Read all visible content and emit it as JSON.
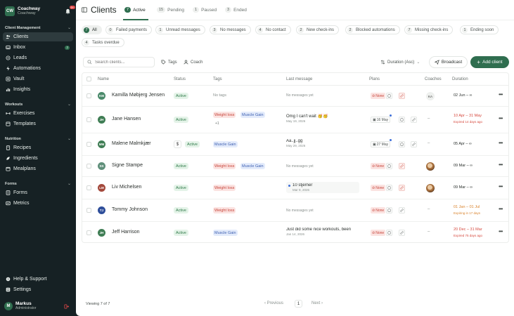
{
  "brand": {
    "logo_text": "CW",
    "name": "Coachway",
    "subtitle": "Coachway",
    "notifications": "9+"
  },
  "sidebar": {
    "sections": [
      {
        "title": "Client Management"
      },
      {
        "title": "Workouts"
      },
      {
        "title": "Nutrition"
      },
      {
        "title": "Forms"
      }
    ],
    "items": [
      {
        "label": "Clients",
        "icon": "users-icon"
      },
      {
        "label": "Inbox",
        "icon": "inbox-icon",
        "count": "2"
      },
      {
        "label": "Leads",
        "icon": "leads-icon"
      },
      {
        "label": "Automations",
        "icon": "automations-icon"
      },
      {
        "label": "Vault",
        "icon": "vault-icon"
      },
      {
        "label": "Insights",
        "icon": "insights-icon"
      },
      {
        "label": "Exercises",
        "icon": "dumbbell-icon"
      },
      {
        "label": "Templates",
        "icon": "templates-icon"
      },
      {
        "label": "Recipes",
        "icon": "recipes-icon"
      },
      {
        "label": "Ingredients",
        "icon": "ingredients-icon"
      },
      {
        "label": "Mealplans",
        "icon": "mealplans-icon"
      },
      {
        "label": "Forms",
        "icon": "forms-icon"
      },
      {
        "label": "Metrics",
        "icon": "metrics-icon"
      },
      {
        "label": "Help & Support",
        "icon": "help-icon"
      },
      {
        "label": "Settings",
        "icon": "settings-icon"
      }
    ]
  },
  "user": {
    "initial": "M",
    "name": "Markus",
    "role": "Administrator"
  },
  "header": {
    "title": "Clients",
    "tabs": [
      {
        "count": "7",
        "label": "Active"
      },
      {
        "count": "15",
        "label": "Pending"
      },
      {
        "count": "1",
        "label": "Paused"
      },
      {
        "count": "3",
        "label": "Ended"
      }
    ]
  },
  "filters": [
    {
      "count": "7",
      "label": "All"
    },
    {
      "count": "0",
      "label": "Failed payments"
    },
    {
      "count": "1",
      "label": "Unread messages"
    },
    {
      "count": "3",
      "label": "No messages"
    },
    {
      "count": "4",
      "label": "No contact"
    },
    {
      "count": "2",
      "label": "New check-ins"
    },
    {
      "count": "2",
      "label": "Blocked automations"
    },
    {
      "count": "7",
      "label": "Missing check-ins"
    },
    {
      "count": "1",
      "label": "Ending soon"
    },
    {
      "count": "4",
      "label": "Tasks overdue"
    }
  ],
  "toolbar": {
    "search_placeholder": "Search clients...",
    "tags_label": "Tags",
    "coach_label": "Coach",
    "sort_label": "Duration (Asc)",
    "broadcast_label": "Broadcast",
    "add_label": "Add client"
  },
  "table": {
    "columns": [
      "Name",
      "Status",
      "Tags",
      "Last message",
      "Plans",
      "Coaches",
      "Duration"
    ],
    "no_tags": "No tags",
    "no_messages": "No messages yet",
    "plan_none": "None",
    "rows": [
      {
        "initials": "KM",
        "avatar_color": "#4a8a6a",
        "name": "Kamilla Møbjerg Jensen",
        "status": "Active",
        "tags": [],
        "message": "",
        "message_date": "",
        "plan": "None",
        "coach": "KA",
        "duration": "02 Jun –",
        "duration_note": ""
      },
      {
        "initials": "JH",
        "avatar_color": "#3f7d54",
        "name": "Jane Hansen",
        "status": "Active",
        "tags": [
          "Weight loss",
          "Muscle Gain"
        ],
        "tags_more": "+1",
        "message": "Omg I can't wait 🥳🥳",
        "message_date": "May 19, 2026",
        "plan": "16 May",
        "coach": "–",
        "duration": "10 Apr – 31 May",
        "duration_note": "Expired 14 days ago"
      },
      {
        "initials": "MM",
        "avatar_color": "#3f7d54",
        "name": "Malene Malmkjær",
        "status": "Active",
        "tags": [
          "Muscle Gain"
        ],
        "message": "Aa..jj..gg",
        "message_date": "May 29, 2026",
        "plan": "27 May",
        "coach": "–",
        "duration": "05 Apr –",
        "duration_note": ""
      },
      {
        "initials": "SS",
        "avatar_color": "#5f8f7a",
        "name": "Signe Stampe",
        "status": "Active",
        "tags": [
          "Weight loss",
          "Muscle Gain"
        ],
        "message": "",
        "message_date": "",
        "plan": "None",
        "coach": "photo",
        "duration": "09 Mar –",
        "duration_note": ""
      },
      {
        "initials": "LM",
        "avatar_color": "#a3483b",
        "name": "Liv Michelsen",
        "status": "Active",
        "tags": [
          "Weight loss"
        ],
        "message": "10 stjerner",
        "message_date": "Mar 9, 2026",
        "plan": "None",
        "coach": "photo",
        "duration": "09 Mar –",
        "duration_note": ""
      },
      {
        "initials": "TJ",
        "avatar_color": "#2e4e9a",
        "name": "Tommy Johnson",
        "status": "Active",
        "tags": [
          "Weight loss"
        ],
        "message": "",
        "message_date": "",
        "plan": "None",
        "coach": "–",
        "duration": "01 Jan – 01 Jul",
        "duration_note": "Expiring in 17 days"
      },
      {
        "initials": "JH",
        "avatar_color": "#3f7d54",
        "name": "Jeff Harrison",
        "status": "Active",
        "tags": [
          "Muscle Gain"
        ],
        "message": "Just did some nice workouts, been",
        "message_date": "Jan 14, 2026",
        "plan": "None",
        "coach": "–",
        "duration": "20 Dec – 31 Mar",
        "duration_note": "Expired 75 days ago"
      }
    ]
  },
  "footer": {
    "viewing": "Viewing 7 of 7",
    "prev": "Previous",
    "page": "1",
    "next": "Next"
  },
  "colors": {
    "accent": "#2f6e4f",
    "sidebar_bg": "#162124",
    "danger": "#d64a3f",
    "warning": "#d9822b"
  }
}
